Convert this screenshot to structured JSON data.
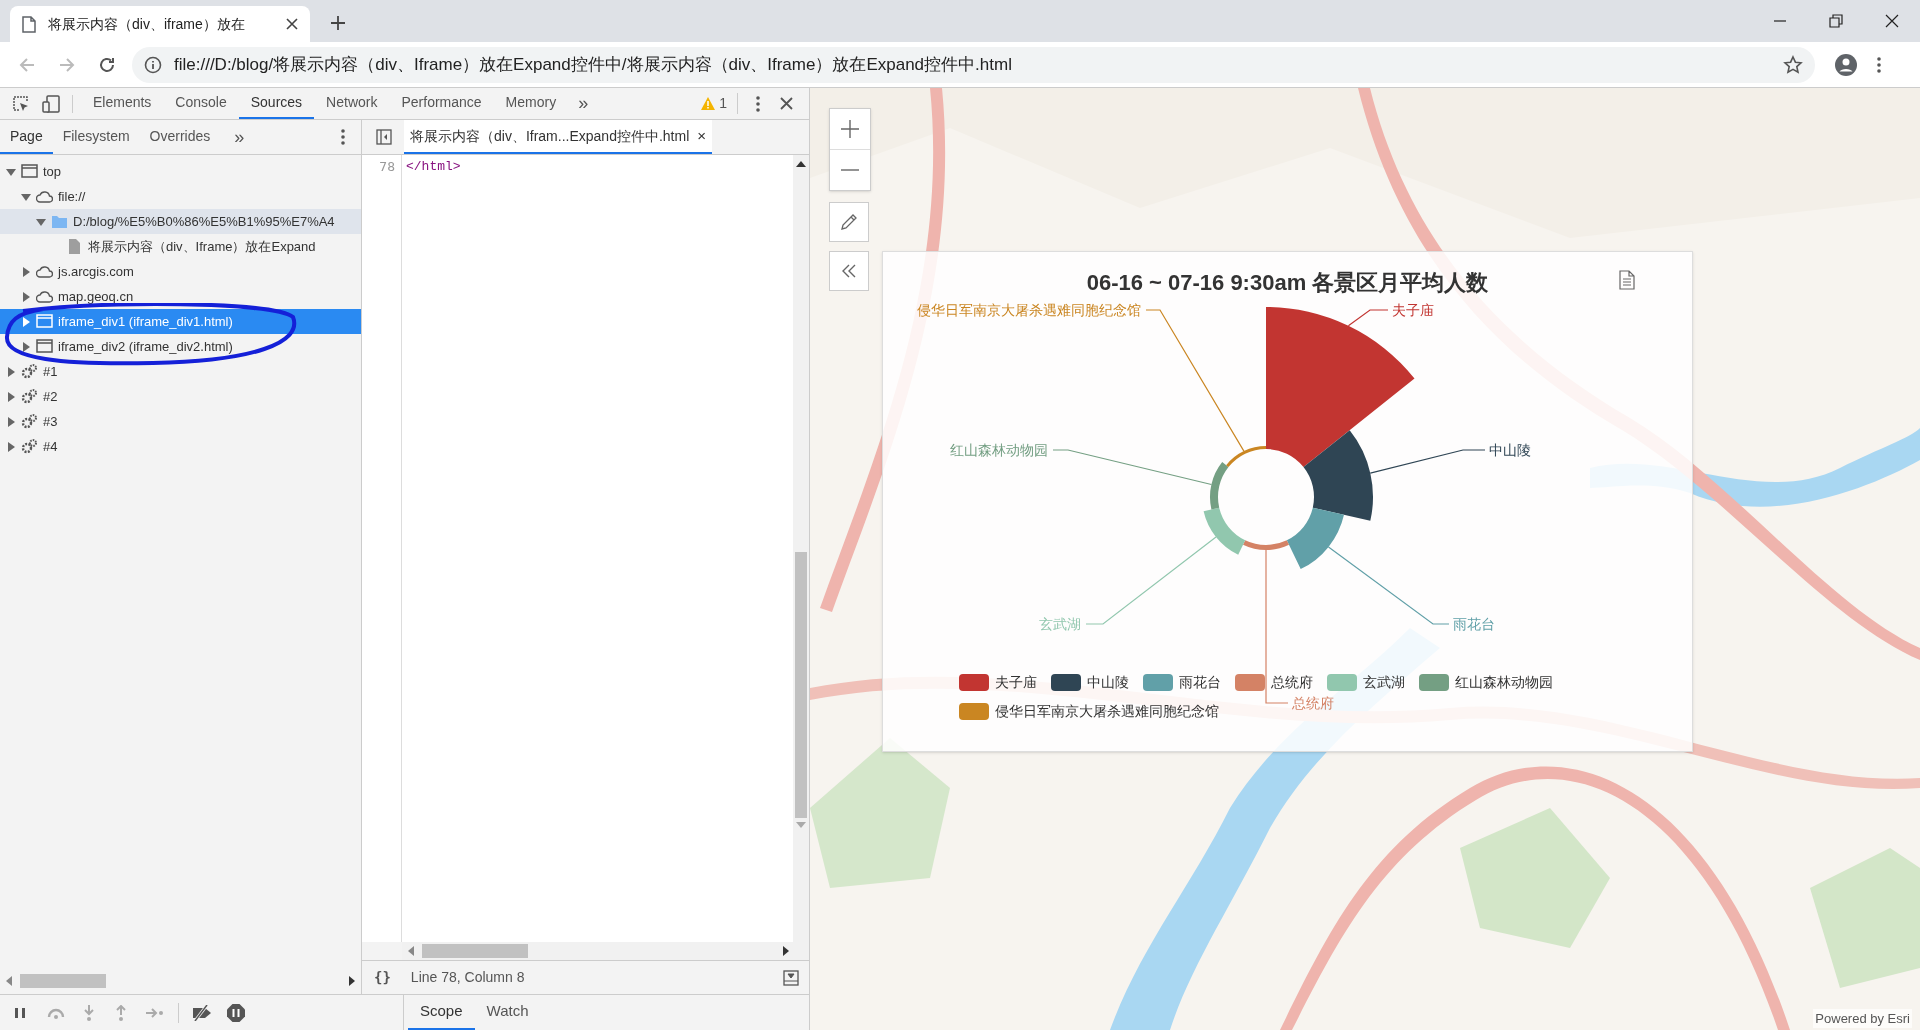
{
  "browser": {
    "tab": {
      "title": "将展示内容（div、iframe）放在"
    },
    "address": "file:///D:/blog/将展示内容（div、Iframe）放在Expand控件中/将展示内容（div、Iframe）放在Expand控件中.html"
  },
  "devtools": {
    "tabs": [
      {
        "label": "Elements",
        "selected": false
      },
      {
        "label": "Console",
        "selected": false
      },
      {
        "label": "Sources",
        "selected": true
      },
      {
        "label": "Network",
        "selected": false
      },
      {
        "label": "Performance",
        "selected": false
      },
      {
        "label": "Memory",
        "selected": false
      }
    ],
    "more": "»",
    "warning_count": "1",
    "navigator_tabs": [
      {
        "label": "Page",
        "selected": true
      },
      {
        "label": "Filesystem",
        "selected": false
      },
      {
        "label": "Overrides",
        "selected": false
      }
    ],
    "navigator_more": "»",
    "tree": [
      {
        "label": "top",
        "kind": "frame",
        "expanded": true,
        "selected": false,
        "hovered": false,
        "children": [
          {
            "label": "file://",
            "kind": "cloud",
            "expanded": true,
            "selected": false,
            "hovered": false,
            "children": [
              {
                "label": "D:/blog/%E5%B0%86%E5%B1%95%E7%A4",
                "kind": "folder",
                "expanded": true,
                "selected": false,
                "hovered": true,
                "children": [
                  {
                    "label": "将展示内容（div、Iframe）放在Expand",
                    "kind": "file",
                    "selected": false,
                    "hovered": false
                  }
                ]
              }
            ]
          },
          {
            "label": "js.arcgis.com",
            "kind": "cloud",
            "expanded": false,
            "selected": false,
            "hovered": false
          },
          {
            "label": "map.geoq.cn",
            "kind": "cloud",
            "expanded": false,
            "selected": false,
            "hovered": false
          },
          {
            "label": "iframe_div1 (iframe_div1.html)",
            "kind": "frame",
            "expanded": false,
            "selected": true
          },
          {
            "label": "iframe_div2 (iframe_div2.html)",
            "kind": "frame",
            "expanded": false,
            "selected": false,
            "hovered": false
          }
        ]
      },
      {
        "label": "#1",
        "kind": "gear",
        "expanded": false,
        "selected": false,
        "hovered": false
      },
      {
        "label": "#2",
        "kind": "gear",
        "expanded": false,
        "selected": false,
        "hovered": false
      },
      {
        "label": "#3",
        "kind": "gear",
        "expanded": false,
        "selected": false,
        "hovered": false
      },
      {
        "label": "#4",
        "kind": "gear",
        "expanded": false,
        "selected": false,
        "hovered": false
      }
    ],
    "editor_tab": {
      "title": "将展示内容（div、Ifram...Expand控件中.html",
      "close": "×"
    },
    "code_lines": [
      {
        "number": "78",
        "text": "</html>"
      }
    ],
    "pretty_print": "{}",
    "status": "Line 78, Column 8",
    "sidebar_tabs": [
      {
        "label": "Scope",
        "selected": true
      },
      {
        "label": "Watch",
        "selected": false
      }
    ]
  },
  "map": {
    "chart": {
      "title": "06-16 ~ 07-16 9:30am 各景区月平均人数",
      "slice_labels": [
        {
          "name": "侵华日军南京大屠杀遇难同胞纪念馆",
          "color": "#ca8622"
        },
        {
          "name": "夫子庙",
          "color": "#c23531"
        },
        {
          "name": "红山森林动物园",
          "color": "#749f83"
        },
        {
          "name": "中山陵",
          "color": "#2f4554"
        },
        {
          "name": "玄武湖",
          "color": "#91c7ae"
        },
        {
          "name": "雨花台",
          "color": "#61a0a8"
        },
        {
          "name": "总统府",
          "color": "#d48265"
        }
      ],
      "legend": [
        {
          "name": "夫子庙",
          "color": "#c23531"
        },
        {
          "name": "中山陵",
          "color": "#2f4554"
        },
        {
          "name": "雨花台",
          "color": "#61a0a8"
        },
        {
          "name": "总统府",
          "color": "#d48265"
        },
        {
          "name": "玄武湖",
          "color": "#91c7ae"
        },
        {
          "name": "红山森林动物园",
          "color": "#749f83"
        },
        {
          "name": "侵华日军南京大屠杀遇难同胞纪念馆",
          "color": "#ca8622"
        }
      ]
    },
    "attribution": "Powered by Esri"
  }
}
